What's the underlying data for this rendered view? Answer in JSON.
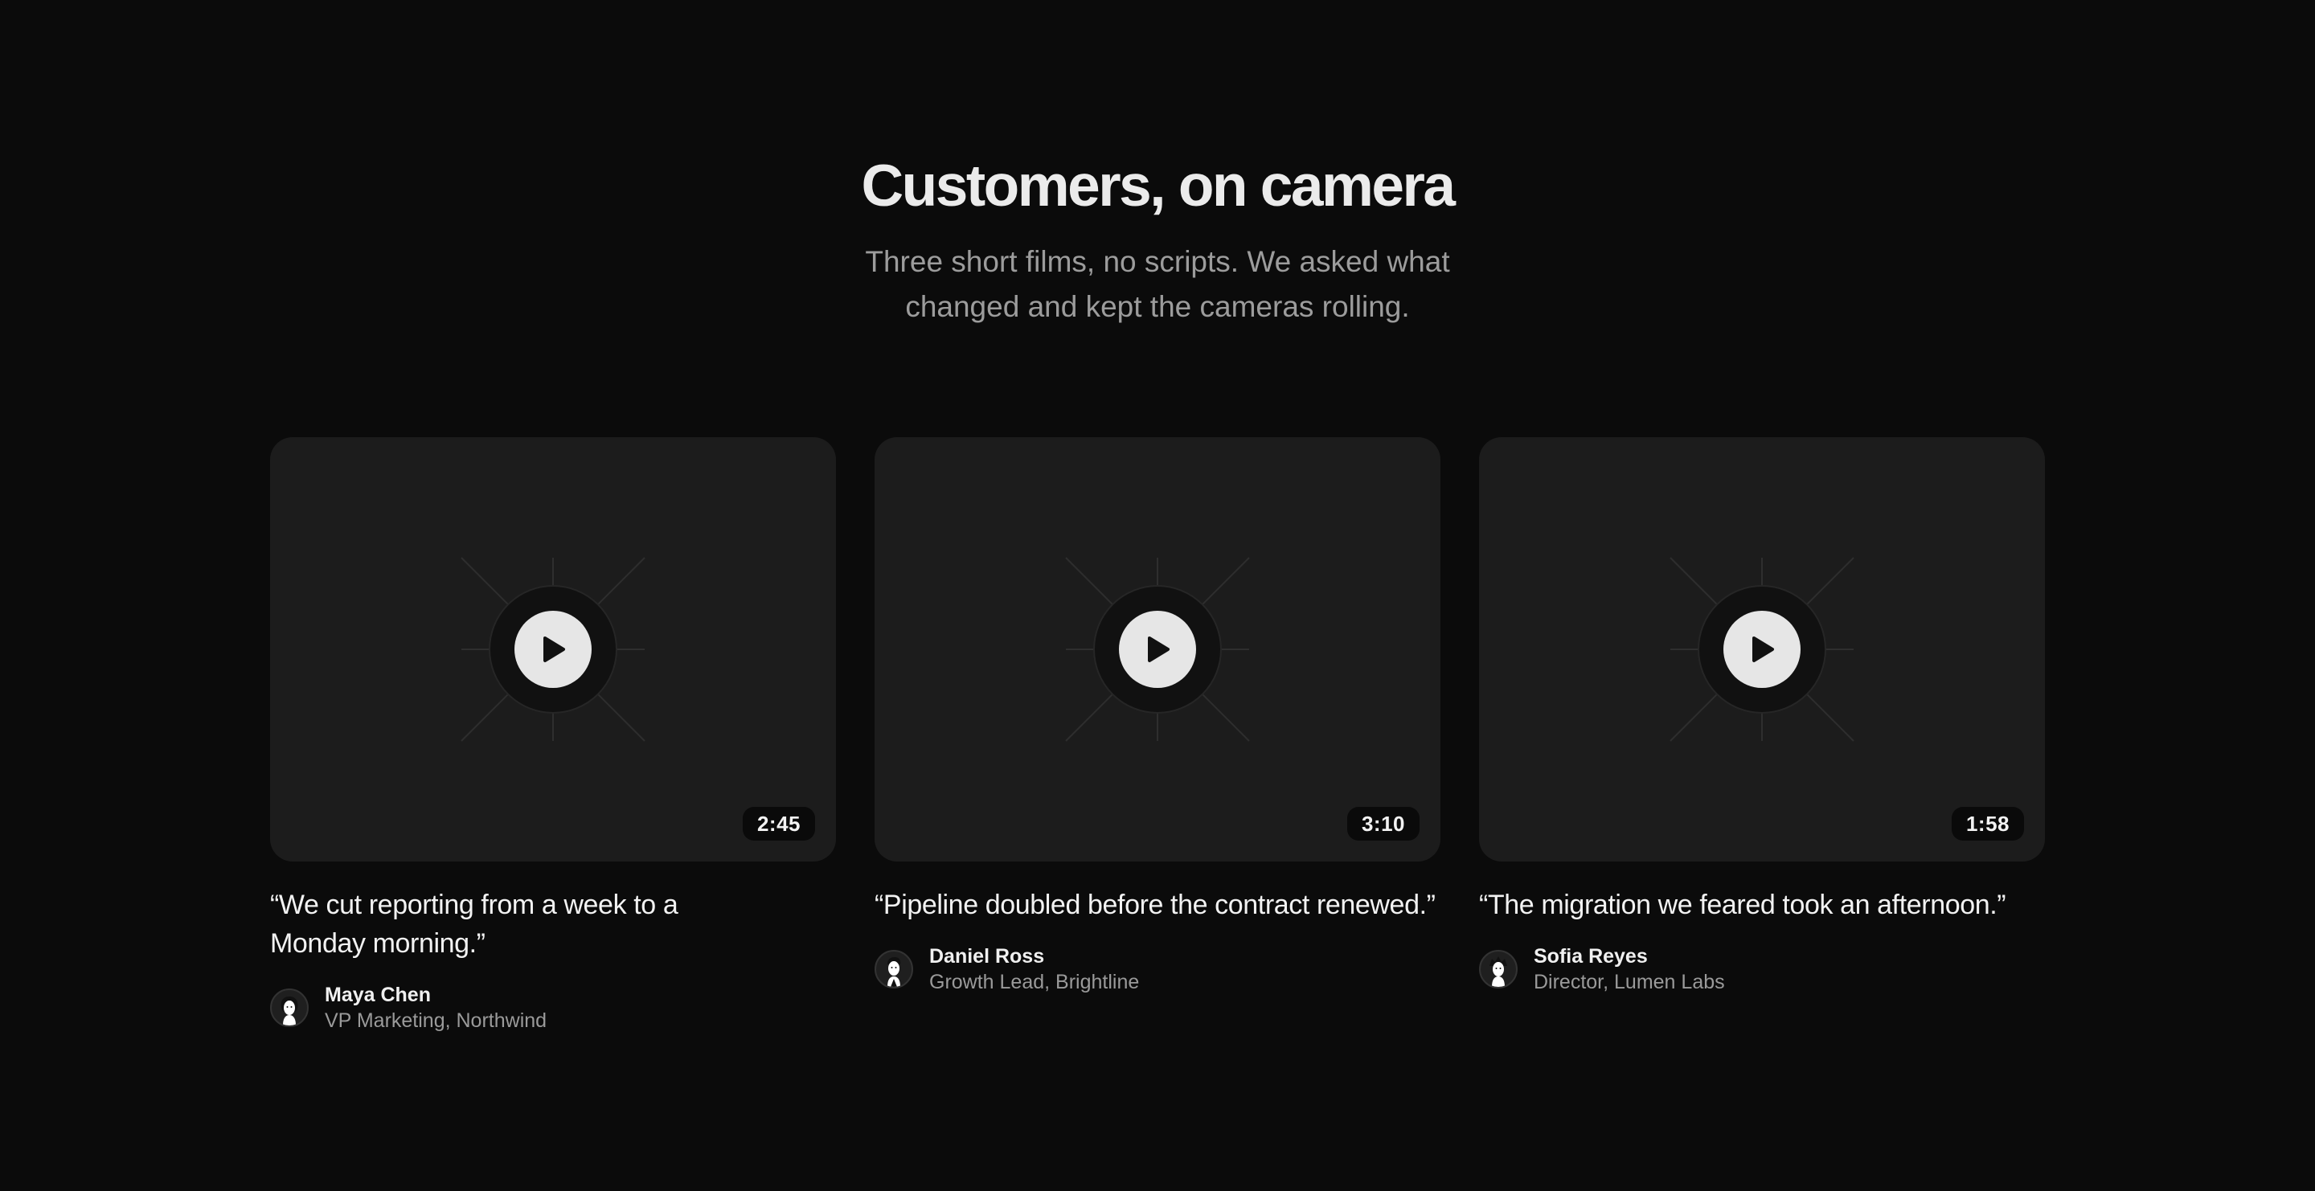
{
  "header": {
    "title": "Customers, on camera",
    "subtitle": "Three short films, no scripts. We asked what changed and kept the cameras rolling."
  },
  "videos": [
    {
      "duration": "2:45",
      "quote": "“We cut reporting from a week to a Monday morning.”",
      "author_name": "Maya Chen",
      "author_role": "VP Marketing, Northwind"
    },
    {
      "duration": "3:10",
      "quote": "“Pipeline doubled before the contract renewed.”",
      "author_name": "Daniel Ross",
      "author_role": "Growth Lead, Brightline"
    },
    {
      "duration": "1:58",
      "quote": "“The migration we feared took an afternoon.”",
      "author_name": "Sofia Reyes",
      "author_role": "Director, Lumen Labs"
    }
  ],
  "icons": {
    "play": "play-icon",
    "avatar": "avatar-illustration"
  },
  "colors": {
    "background": "#0b0b0b",
    "card": "#1c1c1c",
    "play_button": "#e6e6e6",
    "text_primary": "#ebebeb",
    "text_muted": "#9c9c9c"
  }
}
